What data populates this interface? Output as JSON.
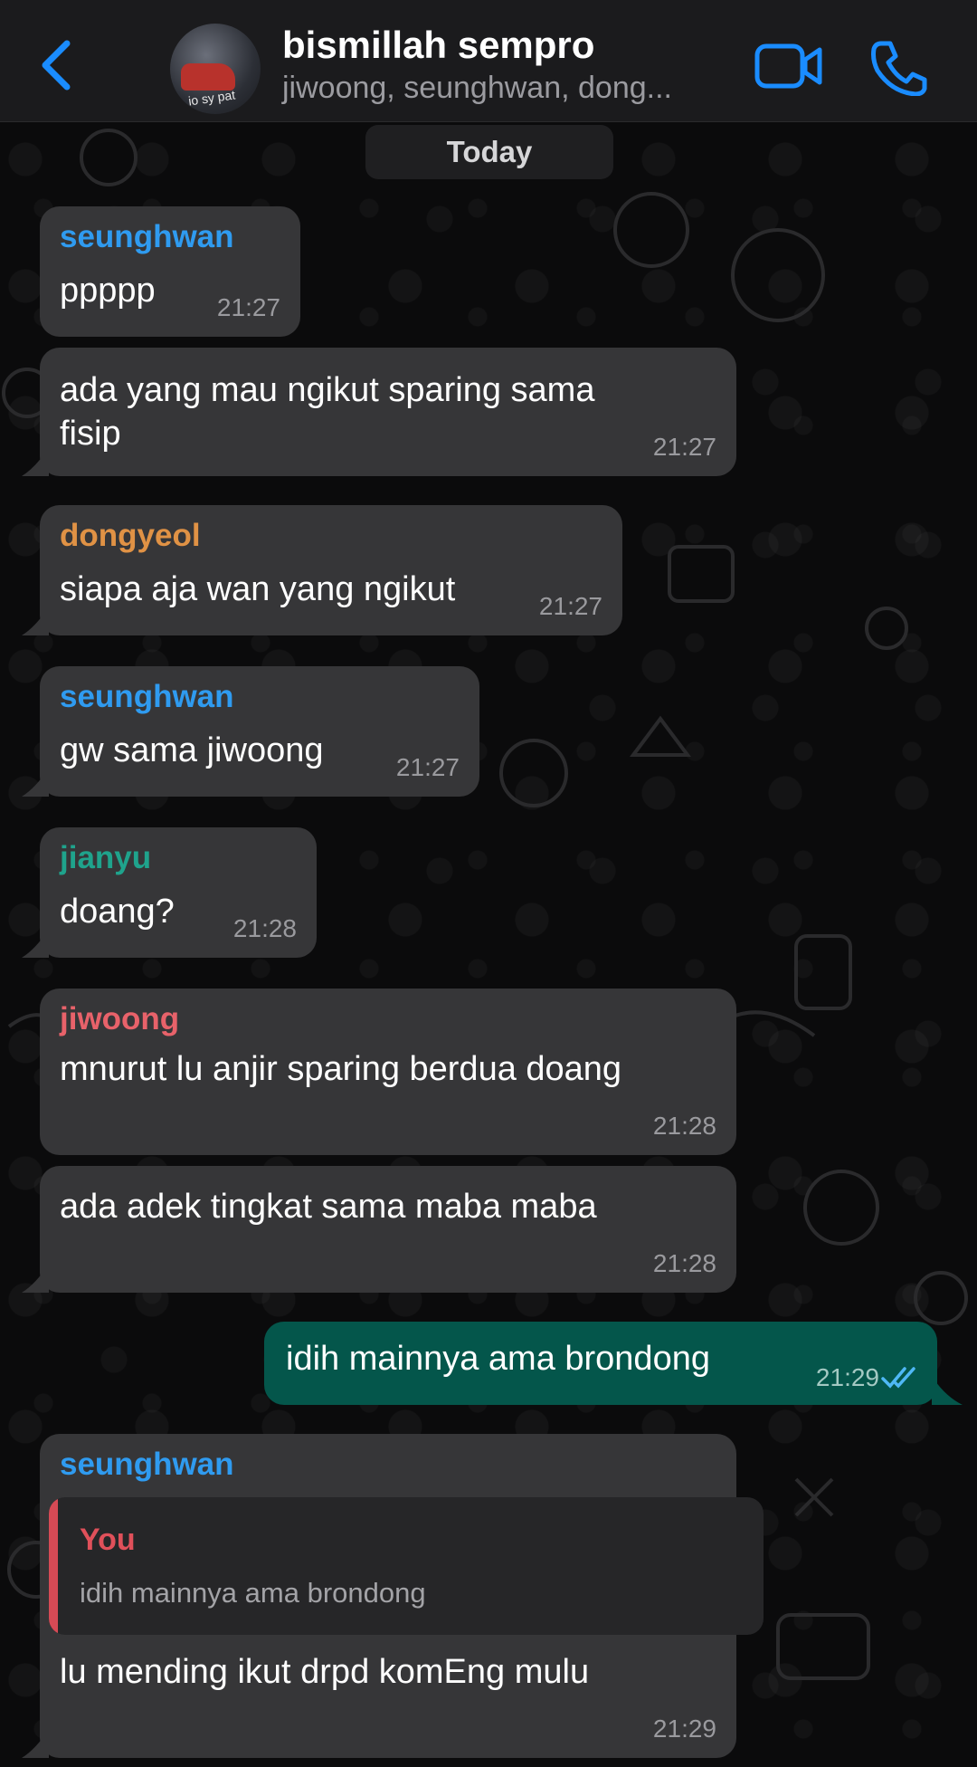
{
  "header": {
    "title": "bismillah sempro",
    "subtitle": "jiwoong, seunghwan, dong...",
    "avatar_caption": "io sy pat"
  },
  "date_divider": "Today",
  "colors": {
    "accent": "#1a8cff",
    "seunghwan": "#2f9bf0",
    "dongyeol": "#e09245",
    "jianyu": "#1fa38c",
    "jiwoong": "#e8626a",
    "you_quote": "#e0505a",
    "outgoing_bubble": "#04564b",
    "incoming_bubble": "#363638"
  },
  "messages": [
    {
      "sender": "seunghwan",
      "text": "ppppp",
      "time": "21:27"
    },
    {
      "text_line1": "ada yang mau ngikut sparing sama",
      "text_line2": "fisip",
      "time": "21:27"
    },
    {
      "sender": "dongyeol",
      "text": "siapa aja wan yang ngikut",
      "time": "21:27"
    },
    {
      "sender": "seunghwan",
      "text": "gw sama jiwoong",
      "time": "21:27"
    },
    {
      "sender": "jianyu",
      "text": "doang?",
      "time": "21:28"
    },
    {
      "sender": "jiwoong",
      "text": "mnurut lu anjir sparing berdua doang",
      "time": "21:28"
    },
    {
      "text": "ada adek tingkat sama maba maba",
      "time": "21:28"
    },
    {
      "text": "idih mainnya ama brondong",
      "time": "21:29",
      "status_icon": "double-check-icon"
    },
    {
      "sender": "seunghwan",
      "quote_name": "You",
      "quote_text": "idih mainnya ama brondong",
      "text": "lu mending ikut drpd komEng mulu",
      "time": "21:29"
    }
  ]
}
